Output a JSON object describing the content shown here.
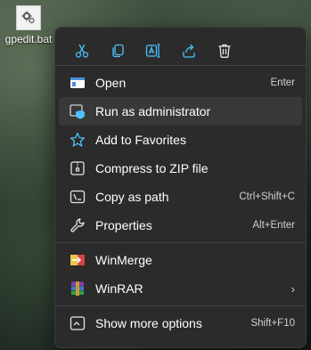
{
  "desktop": {
    "file_name": "gpedit.bat"
  },
  "quick_actions": [
    {
      "name": "cut-icon",
      "label": ""
    },
    {
      "name": "copy-icon",
      "label": ""
    },
    {
      "name": "rename-icon",
      "label": ""
    },
    {
      "name": "share-icon",
      "label": ""
    },
    {
      "name": "delete-icon",
      "label": ""
    }
  ],
  "menu": {
    "section1": [
      {
        "icon": "open-window-icon",
        "label": "Open",
        "shortcut": "Enter"
      },
      {
        "icon": "admin-shield-icon",
        "label": "Run as administrator",
        "shortcut": ""
      },
      {
        "icon": "star-icon",
        "label": "Add to Favorites",
        "shortcut": ""
      },
      {
        "icon": "zip-folder-icon",
        "label": "Compress to ZIP file",
        "shortcut": ""
      },
      {
        "icon": "copy-path-icon",
        "label": "Copy as path",
        "shortcut": "Ctrl+Shift+C"
      },
      {
        "icon": "wrench-icon",
        "label": "Properties",
        "shortcut": "Alt+Enter"
      }
    ],
    "section2": [
      {
        "icon": "winmerge-icon",
        "label": "WinMerge"
      },
      {
        "icon": "winrar-icon",
        "label": "WinRAR",
        "submenu": "›"
      }
    ],
    "section3": [
      {
        "icon": "more-options-icon",
        "label": "Show more options",
        "shortcut": "Shift+F10"
      }
    ]
  },
  "colors": {
    "menu_bg": "#2b2b2b",
    "accent_blue": "#4cc2ff",
    "highlight": "#383838"
  }
}
